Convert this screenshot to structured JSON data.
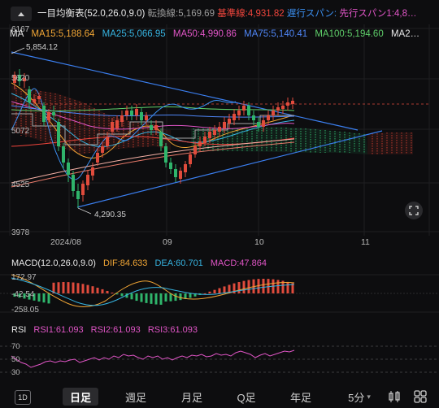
{
  "header": {
    "title": "一目均衡表(52.0,26.0,9.0)",
    "tenkan": "転換線:5,169.69",
    "kijun": "基準線:4,931.82",
    "chikou": "遅行スパン:",
    "senkou": "先行スパン1:4,8…"
  },
  "ma": {
    "label": "MA",
    "ma15": "MA15:5,188.64",
    "ma25": "MA25:5,066.95",
    "ma50": "MA50:4,990.86",
    "ma75": "MA75:5,140.41",
    "ma100": "MA100:5,194.60",
    "ma2": "MA2…"
  },
  "price_axis": [
    "6167",
    "5620",
    "5072",
    "4525",
    "3978"
  ],
  "annotations": {
    "high": "5,854.12",
    "low": "4,290.35"
  },
  "time_axis": [
    "2024/08",
    "09",
    "10",
    "11"
  ],
  "macd": {
    "title": "MACD(12.0,26.0,9.0)",
    "dif": "DIF:84.633",
    "dea": "DEA:60.701",
    "macd": "MACD:47.864",
    "axis": [
      "172.97",
      "-42.54",
      "-258.05"
    ]
  },
  "rsi": {
    "title": "RSI",
    "rsi1": "RSI1:61.093",
    "rsi2": "RSI2:61.093",
    "rsi3": "RSI3:61.093",
    "axis": [
      "70",
      "50",
      "30"
    ]
  },
  "bottom": {
    "range_btn": "1D",
    "tabs": [
      "日足",
      "週足",
      "月足",
      "Q足",
      "年足"
    ],
    "interval": "5分",
    "interval_arrow": "▾"
  },
  "colors": {
    "background": "#0d0d0f",
    "up": "#e04b3c",
    "down": "#2fb56b",
    "ma15": "#f0a535",
    "ma25": "#36b3e0",
    "ma50": "#e055c6",
    "ma75": "#4f86f7",
    "ma100": "#5fcf6a",
    "tenkan": "#a8a8a8",
    "kijun": "#f0453c",
    "chikou": "#3b8ff0",
    "senkou": "#e055c6",
    "dif": "#f0a535",
    "dea": "#36b3e0",
    "rsi1": "#e055c6"
  }
}
